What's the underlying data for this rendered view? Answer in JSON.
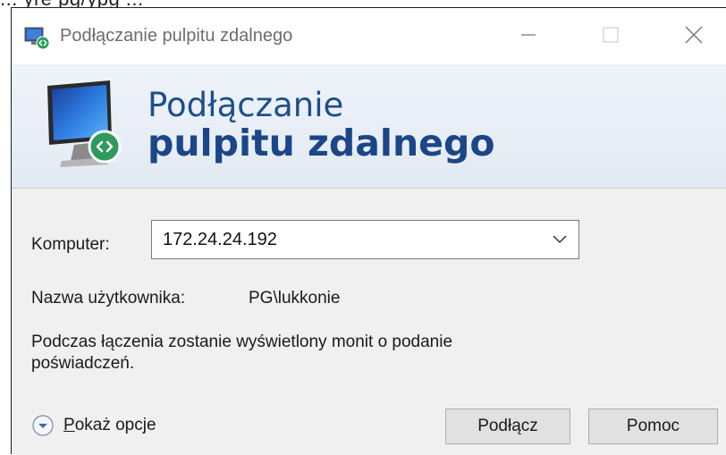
{
  "partial_top_text": "   ...    yre   pg/ypg ...",
  "window": {
    "title": "Podłączanie pulpitu zdalnego"
  },
  "banner": {
    "line1": "Podłączanie",
    "line2": "pulpitu zdalnego"
  },
  "form": {
    "computer_label": "Komputer:",
    "computer_value": "172.24.24.192",
    "username_label": "Nazwa użytkownika:",
    "username_value": "PG\\lukkonie",
    "info_text": "Podczas łączenia zostanie wyświetlony monit o podanie poświadczeń."
  },
  "options": {
    "accel_letter": "P",
    "rest": "okaż opcje"
  },
  "buttons": {
    "connect": "Podłącz",
    "help": "Pomoc"
  },
  "colors": {
    "banner_text": "#1b4688",
    "window_bg": "#f0f0f0"
  }
}
